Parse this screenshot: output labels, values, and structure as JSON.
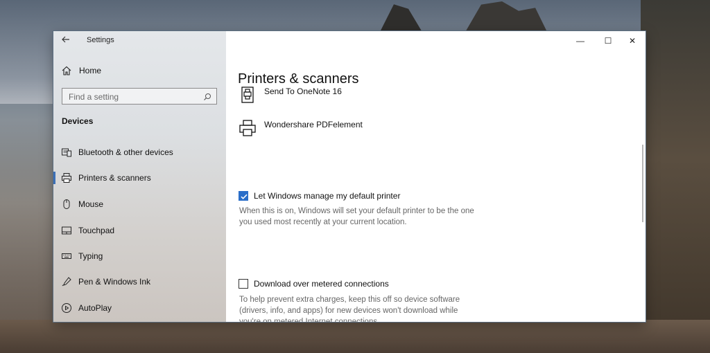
{
  "window": {
    "app_title": "Settings",
    "controls": {
      "minimize": "—",
      "maximize": "☐",
      "close": "✕"
    }
  },
  "sidebar": {
    "home_label": "Home",
    "search_placeholder": "Find a setting",
    "section_title": "Devices",
    "items": [
      {
        "label": "Bluetooth & other devices",
        "icon": "bluetooth-devices-icon",
        "active": false
      },
      {
        "label": "Printers & scanners",
        "icon": "printer-icon",
        "active": true
      },
      {
        "label": "Mouse",
        "icon": "mouse-icon",
        "active": false
      },
      {
        "label": "Touchpad",
        "icon": "touchpad-icon",
        "active": false
      },
      {
        "label": "Typing",
        "icon": "keyboard-icon",
        "active": false
      },
      {
        "label": "Pen & Windows Ink",
        "icon": "pen-icon",
        "active": false
      },
      {
        "label": "AutoPlay",
        "icon": "autoplay-icon",
        "active": false
      }
    ]
  },
  "main": {
    "title": "Printers & scanners",
    "printers": [
      {
        "name": "Send To OneNote 16",
        "icon": "onenote-printer-icon"
      },
      {
        "name": "Wondershare PDFelement",
        "icon": "printer-icon"
      }
    ],
    "default_printer": {
      "label": "Let Windows manage my default printer",
      "checked": true,
      "description_line1": "When this is on, Windows will set your default printer to be the one",
      "description_line2": "you used most recently at your current location."
    },
    "metered": {
      "label": "Download over metered connections",
      "checked": false,
      "description_line1": "To help prevent extra charges, keep this off so device software",
      "description_line2": "(drivers, info, and apps) for new devices won't download while",
      "description_line3": "you're on metered Internet connections."
    }
  },
  "colors": {
    "accent": "#2a6ec9",
    "active_bar": "#3b6fb6"
  }
}
